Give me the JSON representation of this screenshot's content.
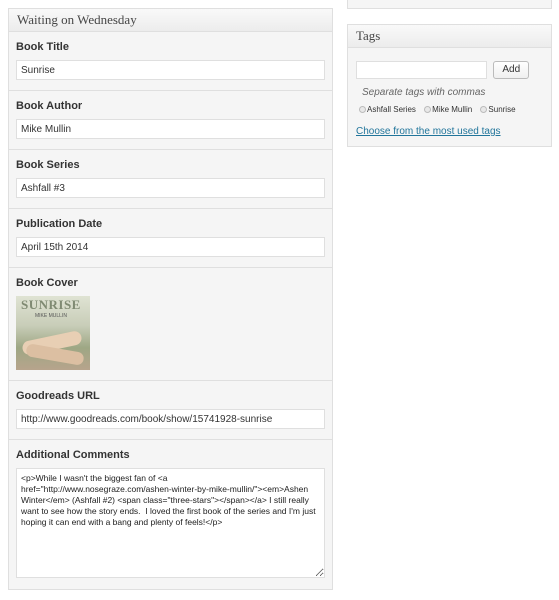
{
  "metabox": {
    "title": "Waiting on Wednesday",
    "fields": [
      {
        "label": "Book Title",
        "value": "Sunrise"
      },
      {
        "label": "Book Author",
        "value": "Mike Mullin"
      },
      {
        "label": "Book Series",
        "value": "Ashfall #3"
      },
      {
        "label": "Publication Date",
        "value": "April 15th 2014"
      }
    ],
    "cover": {
      "label": "Book Cover",
      "title_text": "SUNRISE",
      "author_text": "MIKE MULLIN"
    },
    "goodreads": {
      "label": "Goodreads URL",
      "value": "http://www.goodreads.com/book/show/15741928-sunrise"
    },
    "comments": {
      "label": "Additional Comments",
      "value": "<p>While I wasn't the biggest fan of <a href=\"http://www.nosegraze.com/ashen-winter-by-mike-mullin/\"><em>Ashen Winter</em> (Ashfall #2) <span class=\"three-stars\"></span></a> I still really want to see how the story ends.  I loved the first book of the series and I'm just hoping it can end with a bang and plenty of feels!</p>"
    }
  },
  "tags": {
    "title": "Tags",
    "input_value": "",
    "add_label": "Add",
    "hint": "Separate tags with commas",
    "items": [
      "Ashfall Series",
      "Mike Mullin",
      "Sunrise"
    ],
    "most_used_link": "Choose from the most used tags"
  }
}
